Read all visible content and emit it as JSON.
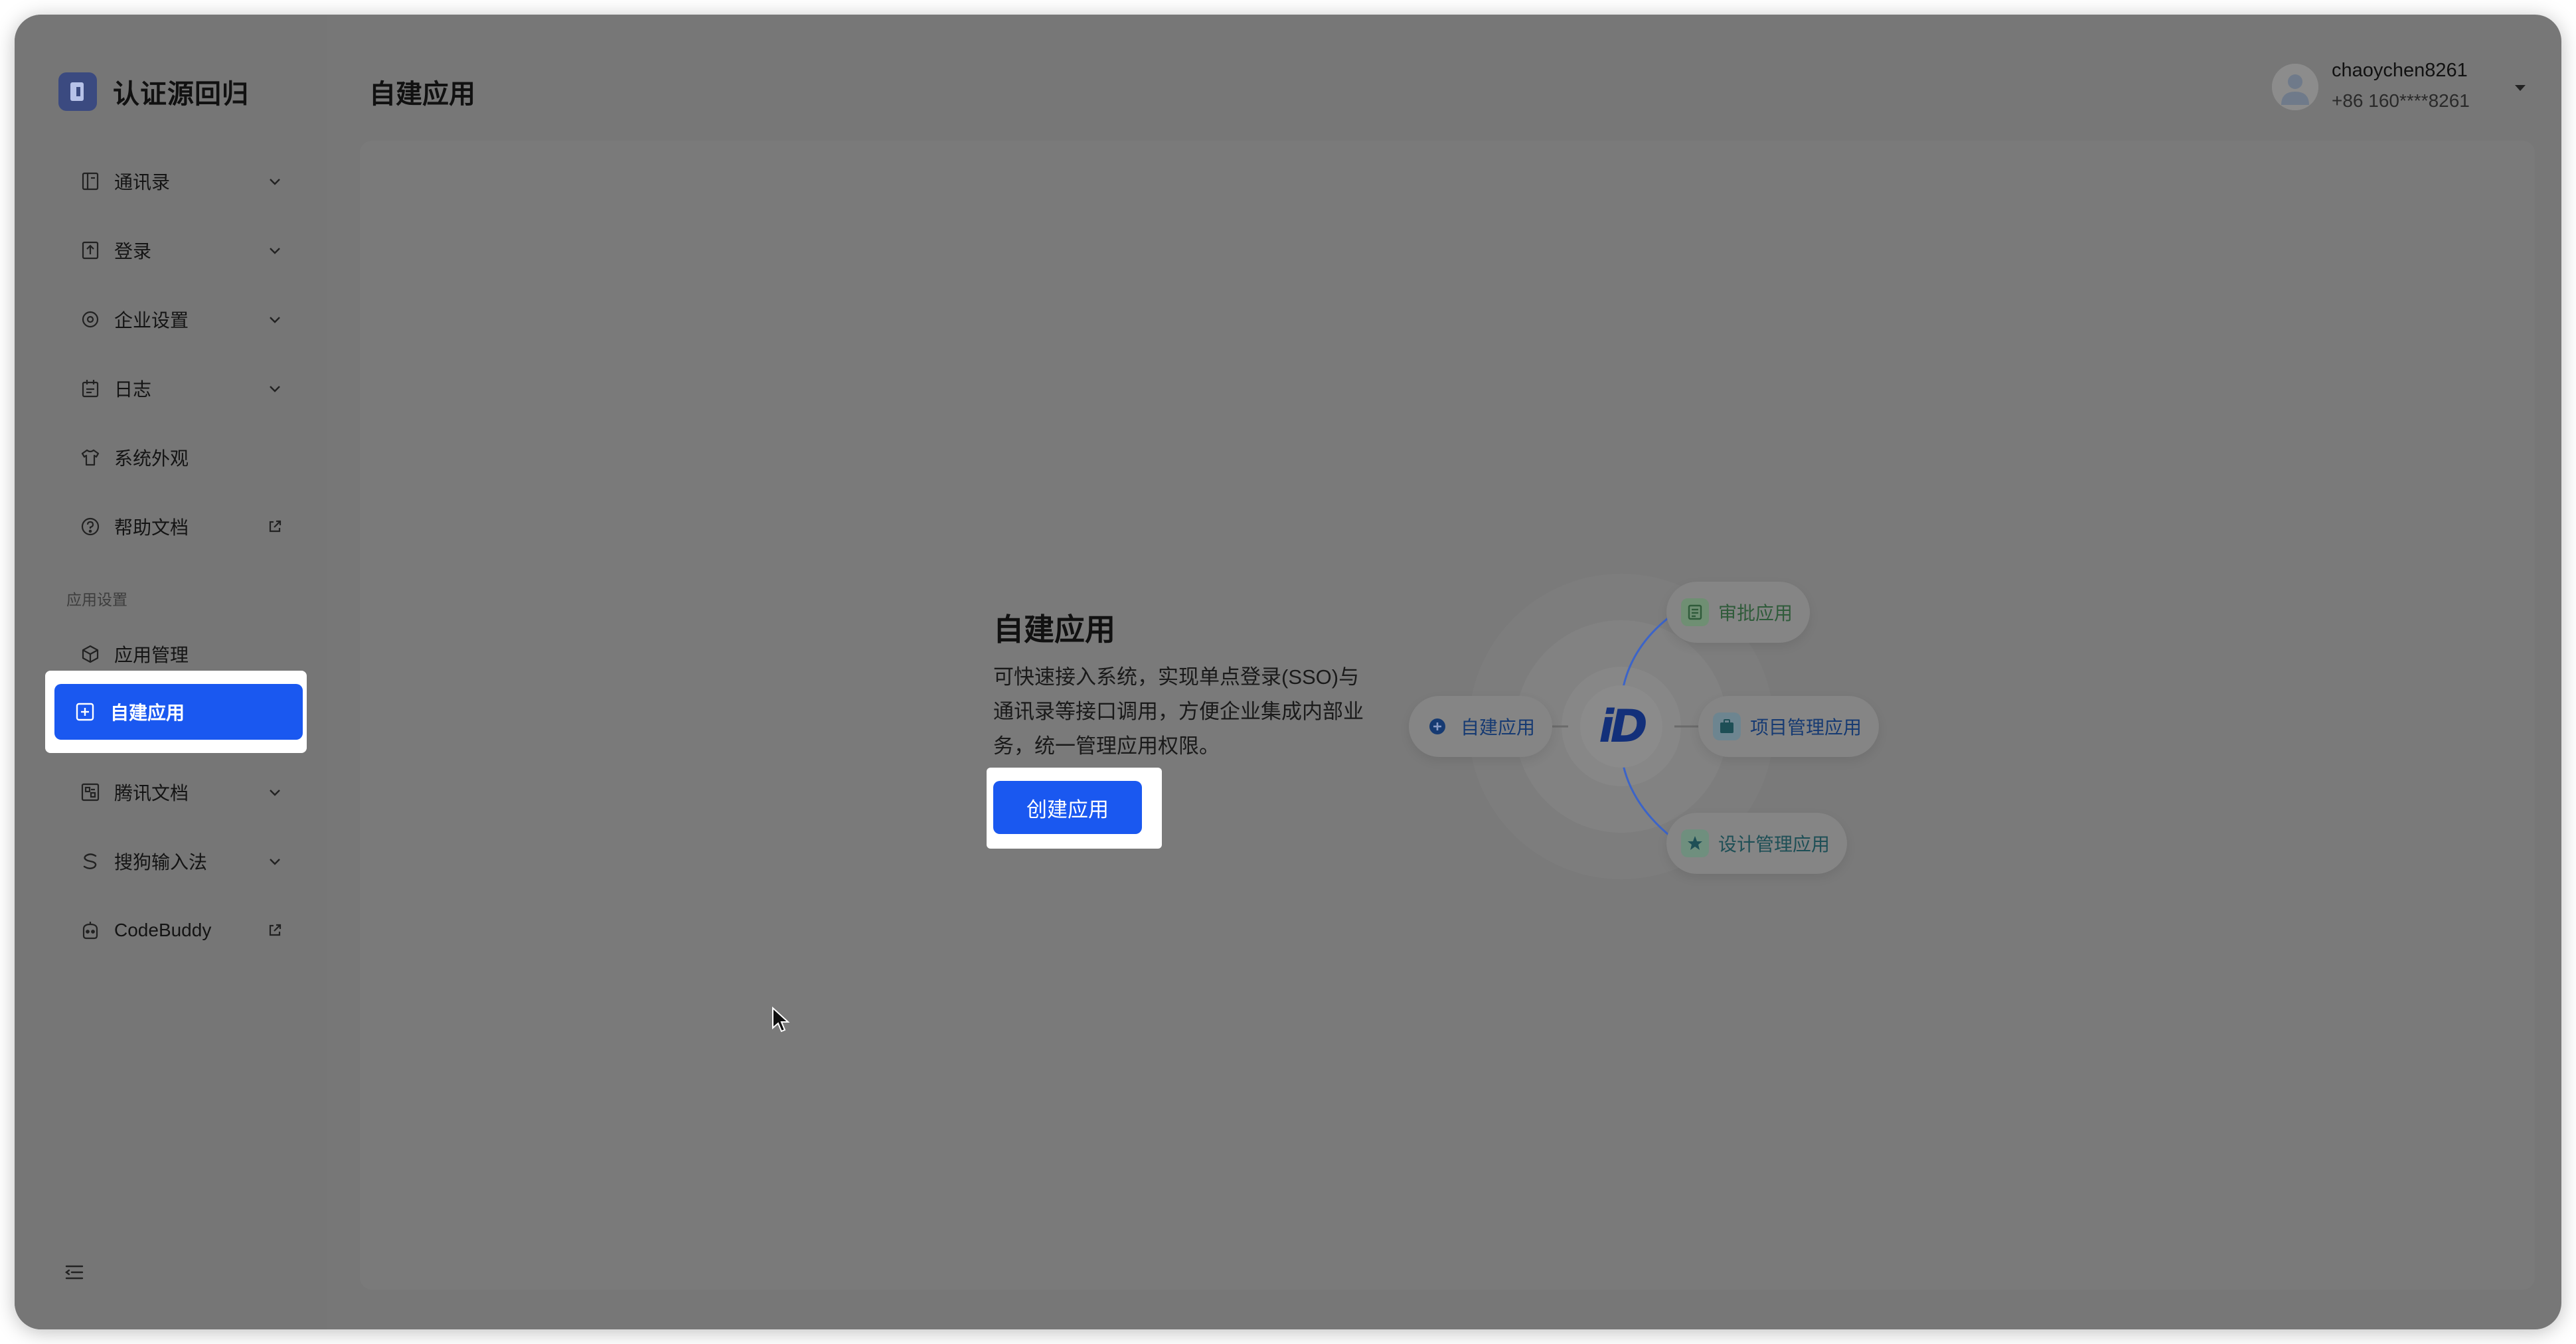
{
  "app": {
    "name": "认证源回归"
  },
  "header": {
    "title": "自建应用",
    "user": {
      "name": "chaoychen8261",
      "phone": "+86 160****8261"
    }
  },
  "sidebar": {
    "items": [
      {
        "label": "通讯录",
        "icon": "book-icon",
        "right": "chevron-down"
      },
      {
        "label": "登录",
        "icon": "login-icon",
        "right": "chevron-down"
      },
      {
        "label": "企业设置",
        "icon": "settings-icon",
        "right": "chevron-down"
      },
      {
        "label": "日志",
        "icon": "calendar-icon",
        "right": "chevron-down"
      },
      {
        "label": "系统外观",
        "icon": "shirt-icon",
        "right": ""
      },
      {
        "label": "帮助文档",
        "icon": "help-icon",
        "right": "external-link"
      }
    ],
    "section_label": "应用设置",
    "app_items": [
      {
        "label": "应用管理",
        "icon": "cube-icon",
        "right": ""
      },
      {
        "label": "自建应用",
        "icon": "plus-square-icon",
        "right": "",
        "active": true
      },
      {
        "label": "腾讯文档",
        "icon": "docs-icon",
        "right": "chevron-down"
      },
      {
        "label": "搜狗输入法",
        "icon": "sogou-icon",
        "right": "chevron-down"
      },
      {
        "label": "CodeBuddy",
        "icon": "codebuddy-icon",
        "right": "external-link"
      }
    ]
  },
  "empty_state": {
    "title": "自建应用",
    "description": "可快速接入系统，实现单点登录(SSO)与通讯录等接口调用，方便企业集成内部业务，统一管理应用权限。",
    "button_label": "创建应用"
  },
  "illustration": {
    "center_logo": "iD",
    "chips": [
      {
        "label": "审批应用",
        "icon": "approval-icon"
      },
      {
        "label": "自建应用",
        "icon": "plus-circle-icon"
      },
      {
        "label": "项目管理应用",
        "icon": "briefcase-icon"
      },
      {
        "label": "设计管理应用",
        "icon": "star-icon"
      }
    ]
  },
  "colors": {
    "accent": "#1a58f0",
    "overlay_gray": "#777777",
    "chip_green": "#2f5b3a",
    "chip_blue": "#163a72",
    "chip_teal": "#1e4f56"
  }
}
